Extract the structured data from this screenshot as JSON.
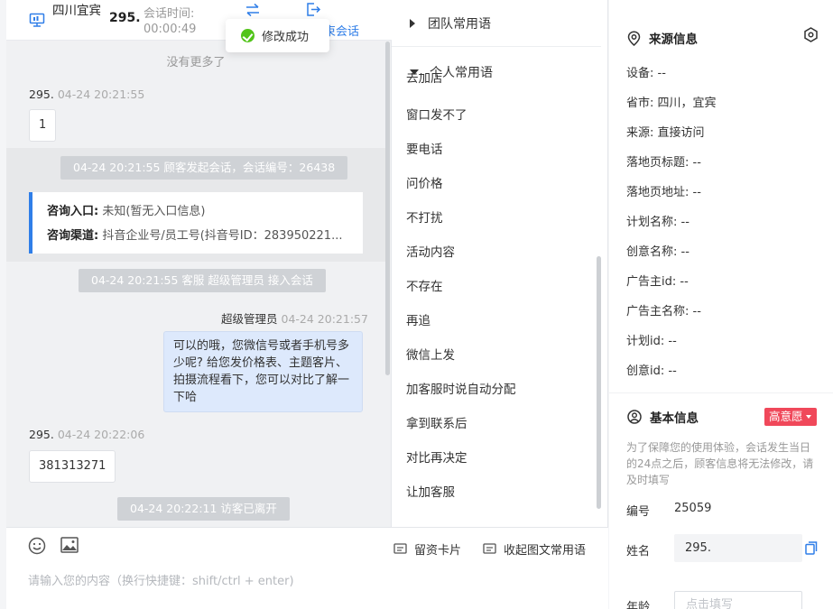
{
  "header": {
    "visitor_name": "四川宜宾",
    "visitor_number": "295.",
    "session_time_label": "会话时间:",
    "session_time_value": "00:00:49",
    "end_chat_label": "束会话"
  },
  "toast": {
    "message": "修改成功"
  },
  "chat": {
    "no_more": "没有更多了",
    "messages": [
      {
        "sender": "295.",
        "time": "04-24 20:21:55",
        "text": "1"
      },
      {
        "system": "04-24 20:21:55 顾客发起会话，会话编号：26438"
      },
      {
        "system": "04-24 20:21:55 客服 超级管理员 接入会话"
      },
      {
        "sender": "超级管理员",
        "time": "04-24 20:21:57",
        "text": "可以的哦，您微信号或者手机号多少呢? 给您发价格表、主题客片、拍摄流程看下，您可以对比了解一下哈"
      },
      {
        "sender": "295.",
        "time": "04-24 20:22:06",
        "text": "381313271"
      },
      {
        "system": "04-24 20:22:11 访客已离开"
      }
    ],
    "info_card": {
      "entry_label": "咨询入口:",
      "entry_value": "未知(暂无入口信息)",
      "channel_label": "咨询渠道:",
      "channel_value": "抖音企业号/员工号(抖音号ID：283950221..."
    }
  },
  "composer": {
    "placeholder": "请输入您的内容（换行快捷键：shift/ctrl + enter)"
  },
  "phrases": {
    "team_label": "团队常用语",
    "personal_label": "个人常用语",
    "cut_item": "去加店",
    "items": [
      "窗口发不了",
      "要电话",
      "问价格",
      "不打扰",
      "活动内容",
      "不存在",
      "再追",
      "微信上发",
      "加客服时说自动分配",
      "拿到联系后",
      "对比再决定",
      "让加客服"
    ],
    "card_button": "留资卡片",
    "collapse_button": "收起图文常用语"
  },
  "source_info": {
    "title": "来源信息",
    "rows": [
      "设备: --",
      "省市: 四川，宜宾",
      "来源: 直接访问",
      "落地页标题: --",
      "落地页地址: --",
      "计划名称: --",
      "创意名称: --",
      "广告主id: --",
      "广告主名称: --",
      "计划id: --",
      "创意id: --"
    ]
  },
  "basic_info": {
    "title": "基本信息",
    "intent_badge": "高意愿",
    "notice": "为了保障您的使用体验，会话发生当日的24点之后，顾客信息将无法修改，请及时填写",
    "id_label": "编号",
    "id_value": "25059",
    "name_label": "姓名",
    "name_value": "295.",
    "age_label": "年龄",
    "age_placeholder": "点击填写"
  },
  "colors": {
    "accent_blue": "#2f7ee8",
    "success_green": "#52c41a",
    "badge_red": "#f0485a",
    "agent_bubble": "#dde9fc"
  }
}
